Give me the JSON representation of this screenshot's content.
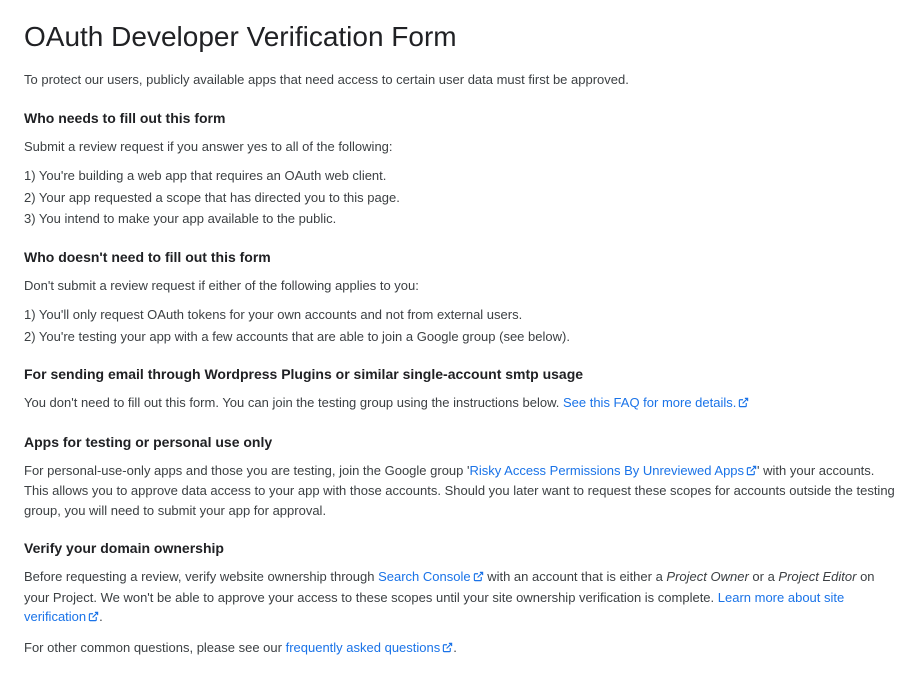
{
  "title": "OAuth Developer Verification Form",
  "intro": "To protect our users, publicly available apps that need access to certain user data must first be approved.",
  "sections": {
    "who_needs": {
      "heading": "Who needs to fill out this form",
      "lead": "Submit a review request if you answer yes to all of the following:",
      "items": [
        "1) You're building a web app that requires an OAuth web client.",
        "2) Your app requested a scope that has directed you to this page.",
        "3) You intend to make your app available to the public."
      ]
    },
    "who_doesnt": {
      "heading": "Who doesn't need to fill out this form",
      "lead": "Don't submit a review request if either of the following applies to you:",
      "items": [
        "1) You'll only request OAuth tokens for your own accounts and not from external users.",
        "2) You're testing your app with a few accounts that are able to join a Google group (see below)."
      ]
    },
    "smtp": {
      "heading": "For sending email through Wordpress Plugins or similar single-account smtp usage",
      "text_before": "You don't need to fill out this form. You can join the testing group using the instructions below. ",
      "link": "See this FAQ for more details."
    },
    "testing": {
      "heading": "Apps for testing or personal use only",
      "text_before": "For personal-use-only apps and those you are testing, join the Google group '",
      "link": "Risky Access Permissions By Unreviewed Apps",
      "text_after": "' with your accounts. This allows you to approve data access to your app with those accounts. Should you later want to request these scopes for accounts outside the testing group, you will need to submit your app for approval."
    },
    "verify": {
      "heading": "Verify your domain ownership",
      "p1_before": "Before requesting a review, verify website ownership through ",
      "p1_link": "Search Console",
      "p1_mid1": " with an account that is either a ",
      "p1_em1": "Project Owner",
      "p1_mid2": " or a ",
      "p1_em2": "Project Editor",
      "p1_mid3": " on your Project. We won't be able to approve your access to these scopes until your site ownership verification is complete. ",
      "p1_link2": "Learn more about site verification",
      "p1_after": ".",
      "p2_before": "For other common questions, please see our ",
      "p2_link": "frequently asked questions",
      "p2_after": "."
    }
  }
}
